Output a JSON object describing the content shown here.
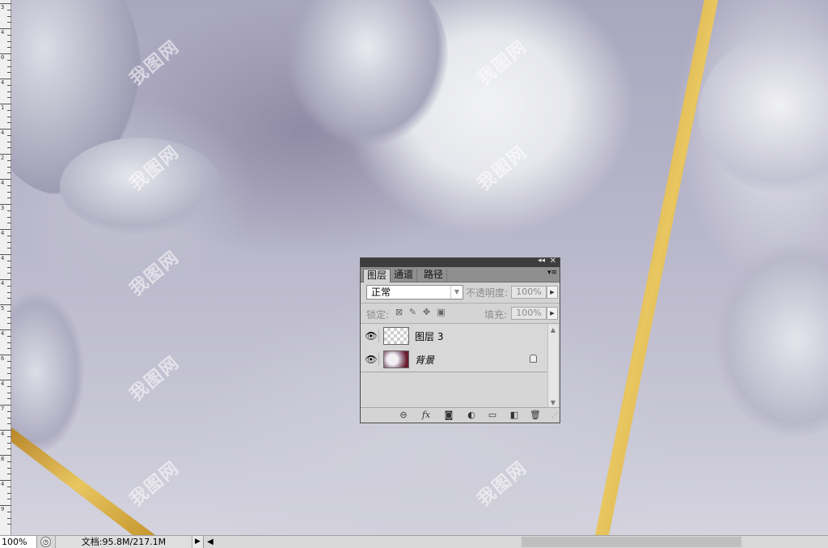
{
  "statusbar": {
    "zoom": "100%",
    "doc_info": "文档:95.8M/217.1M"
  },
  "ruler": {
    "labels": [
      "3",
      "4",
      "0",
      "4",
      "1",
      "4",
      "2",
      "4",
      "3",
      "4",
      "4",
      "4",
      "5",
      "4",
      "6",
      "4",
      "7",
      "4",
      "8",
      "4",
      "9"
    ]
  },
  "watermark": {
    "text": "我图网"
  },
  "layers_panel": {
    "tabs": [
      {
        "label": "图层",
        "active": true
      },
      {
        "label": "通道",
        "active": false
      },
      {
        "label": "路径",
        "active": false
      }
    ],
    "blend_mode": "正常",
    "opacity_label": "不透明度:",
    "opacity_value": "100%",
    "lock_label": "锁定:",
    "fill_label": "填充:",
    "fill_value": "100%",
    "layers": [
      {
        "name": "图层 3",
        "visible": true,
        "thumb": "transparent",
        "locked": false
      },
      {
        "name": "背景",
        "visible": true,
        "thumb": "image",
        "locked": true
      }
    ],
    "footer_icons": [
      "link-icon",
      "fx-icon",
      "mask-icon",
      "adjustment-icon",
      "group-folder-icon",
      "new-layer-icon",
      "trash-icon"
    ]
  },
  "colors": {
    "gold": "#d4a83a",
    "panel_bg": "#d4d4d4",
    "panel_title": "#3d3d3d"
  }
}
